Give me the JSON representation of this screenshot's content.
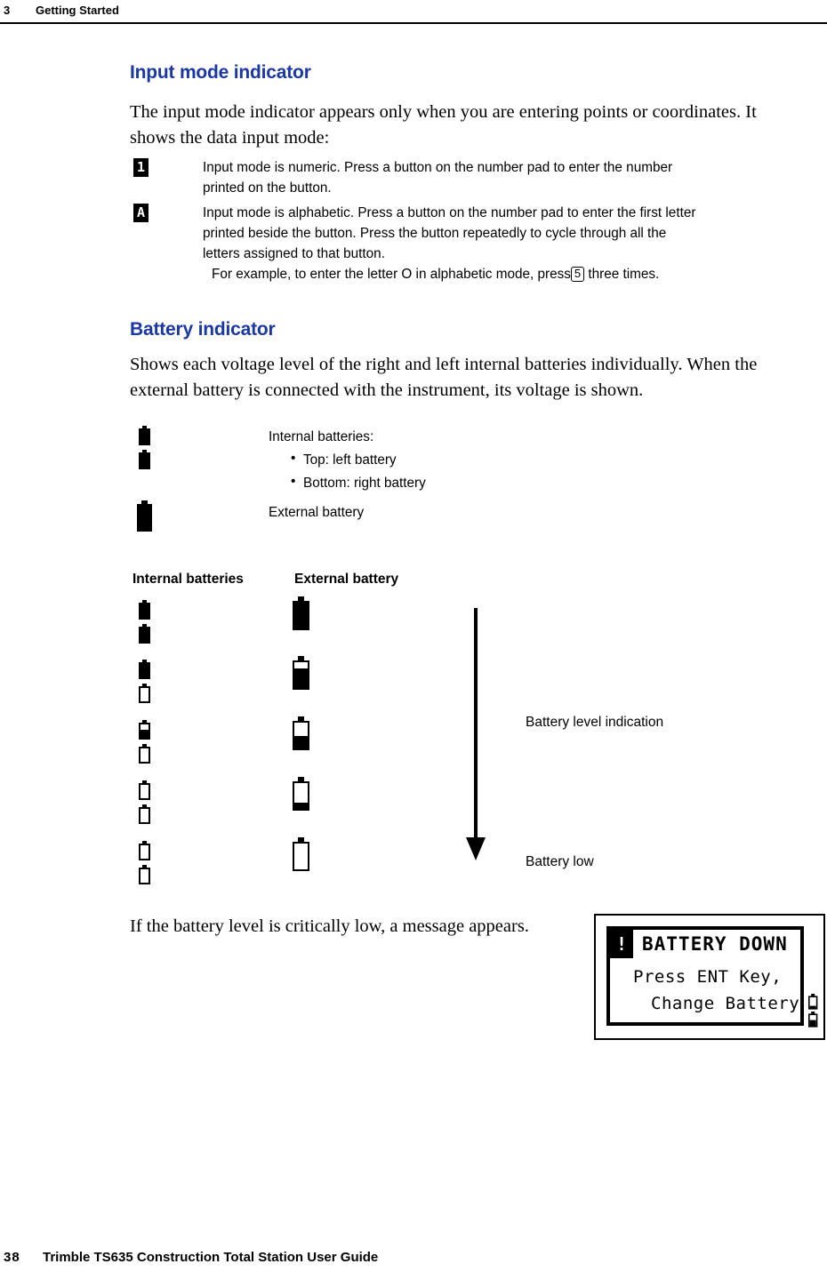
{
  "header": {
    "chapter_number": "3",
    "chapter_title": "Getting Started"
  },
  "footer": {
    "page_number": "38",
    "guide_title": "Trimble TS635 Construction Total Station User Guide"
  },
  "colors": {
    "heading_blue": "#1a37a8",
    "text_black": "#000000",
    "page_background": "#ffffff"
  },
  "sections": {
    "input_mode": {
      "heading": "Input mode indicator",
      "intro_line1": "The input mode indicator appears only when you are entering points or coordinates. It",
      "intro_line2": "shows the data input mode:",
      "entries": [
        {
          "icon_glyph": "1",
          "icon_name": "numeric-mode-indicator",
          "line1": "Input mode is numeric. Press a button on the number pad to enter the number",
          "line2": "printed on the button."
        },
        {
          "icon_glyph": "A",
          "icon_name": "alphabetic-mode-indicator",
          "line1": "Input mode is alphabetic. Press a button on the number pad to enter the first letter",
          "line2": "printed beside the button. Press the button repeatedly to cycle through all the",
          "line3": "letters assigned to that button."
        }
      ],
      "example": {
        "before_key": "For example, to enter the letter O in alphabetic mode, press",
        "key_label": "5",
        "after_key": "three times."
      }
    },
    "battery_indicator": {
      "heading": "Battery indicator",
      "intro_line1": "Shows each voltage level of the right and left internal batteries individually. When the",
      "intro_line2": "external battery is connected with the instrument, its voltage is shown.",
      "legend": {
        "internal_label": "Internal batteries:",
        "internal_bullets": [
          "Top: left battery",
          "Bottom: right battery"
        ],
        "external_label": "External battery"
      },
      "critical_line": "If the battery level is critically low, a message appears."
    }
  },
  "chart_data": {
    "type": "table",
    "title": "Battery level indication chart",
    "columns": [
      "Internal batteries",
      "External battery"
    ],
    "annotations": {
      "arrow_top_label": "Battery level indication",
      "arrow_bottom_label": "Battery low",
      "arrow_direction": "down"
    },
    "rows": [
      {
        "internal_top_pct": 100,
        "internal_bottom_pct": 100,
        "external_pct": 100
      },
      {
        "internal_top_pct": 100,
        "internal_bottom_pct": 0,
        "external_pct": 75
      },
      {
        "internal_top_pct": 60,
        "internal_bottom_pct": 0,
        "external_pct": 50
      },
      {
        "internal_top_pct": 0,
        "internal_bottom_pct": 0,
        "external_pct": 25
      },
      {
        "internal_top_pct": 0,
        "internal_bottom_pct": 0,
        "external_pct": 0
      }
    ]
  },
  "lcd_message": {
    "alert_glyph": "!",
    "title": "BATTERY DOWN",
    "line1": "Press ENT Key,",
    "line2": "Change Battery",
    "status_batteries": [
      {
        "level_pct": 20
      },
      {
        "level_pct": 55
      }
    ]
  }
}
